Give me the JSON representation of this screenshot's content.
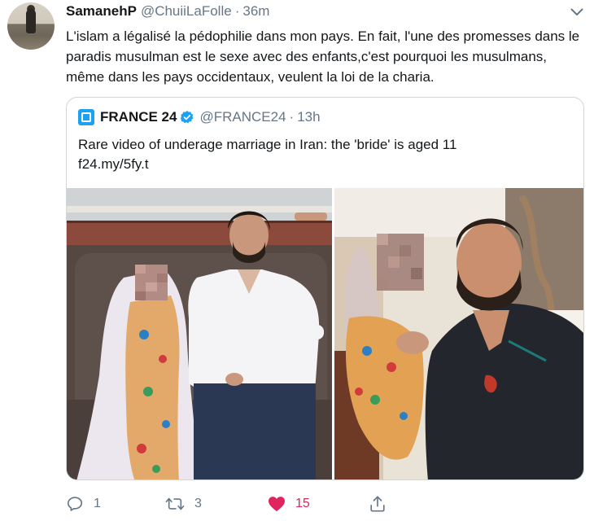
{
  "tweet": {
    "display_name": "SamanehP",
    "handle": "@ChuiiLaFolle",
    "separator": "·",
    "time": "36m",
    "text": "L'islam a légalisé la pédophilie dans mon pays. En fait, l'une des promesses dans le paradis musulman est le sexe avec des enfants,c'est pourquoi les musulmans, même dans les pays occidentaux, veulent la loi de la charia."
  },
  "quoted": {
    "display_name": "FRANCE 24",
    "handle": "@FRANCE24",
    "separator": "·",
    "time": "13h",
    "text_line1": "Rare video of underage marriage in Iran: the 'bride' is aged 11",
    "text_line2": "f24.my/5fy.t"
  },
  "actions": {
    "reply_count": "1",
    "retweet_count": "3",
    "like_count": "15",
    "liked": true
  },
  "icons": {
    "caret": "chevron-down-icon",
    "verified": "verified-badge-icon",
    "reply": "reply-icon",
    "retweet": "retweet-icon",
    "like": "heart-icon",
    "share": "share-icon"
  },
  "colors": {
    "accent": "#1da1f2",
    "like": "#e0245e",
    "secondary_text": "#657786",
    "border": "#ccd6dd"
  }
}
